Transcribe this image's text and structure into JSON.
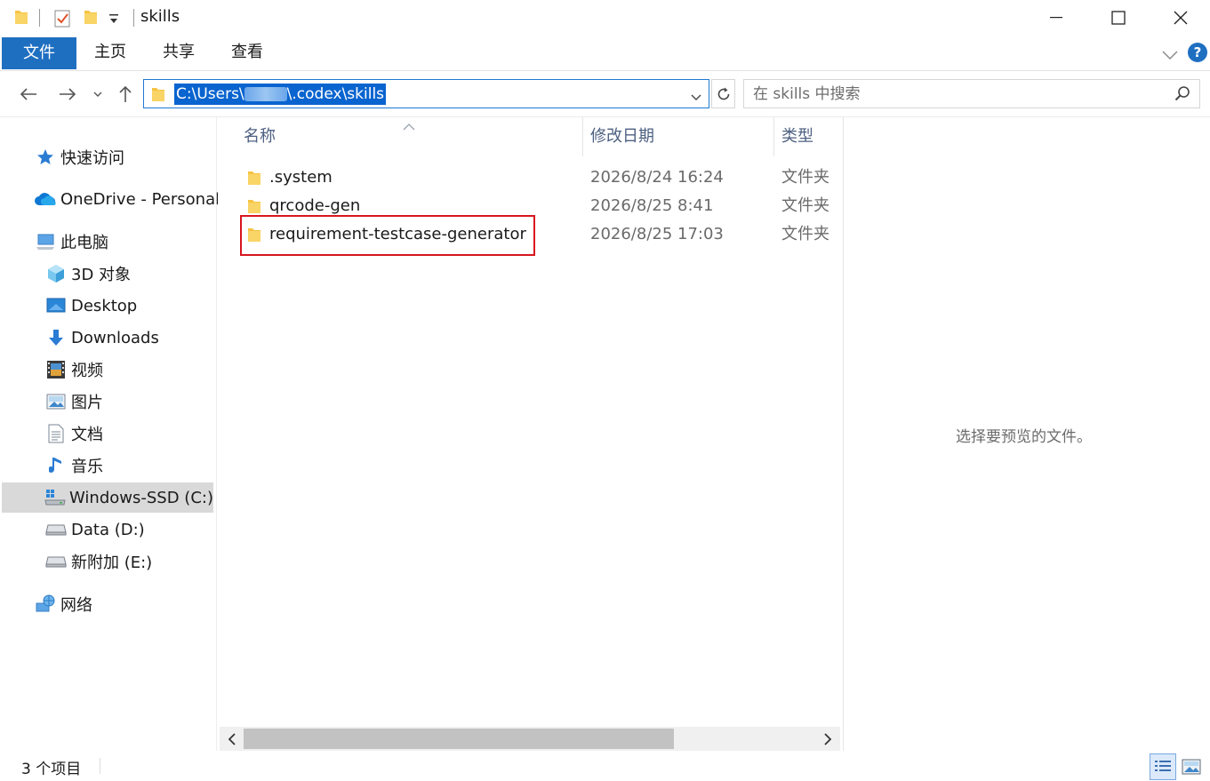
{
  "window": {
    "title": "skills",
    "minimize_glyph": "—",
    "close_glyph": "✕"
  },
  "ribbon": {
    "tabs": [
      {
        "label": "文件",
        "active": true
      },
      {
        "label": "主页"
      },
      {
        "label": "共享"
      },
      {
        "label": "查看"
      }
    ],
    "help_label": "?"
  },
  "address": {
    "path_prefix": "C:\\Users\\",
    "path_suffix": "\\.codex\\skills",
    "search_placeholder": "在 skills 中搜索"
  },
  "sidebar": {
    "items": [
      {
        "label": "快速访问",
        "icon": "star-icon"
      },
      {
        "label": "OneDrive - Personal",
        "icon": "cloud-icon"
      },
      {
        "label": "此电脑",
        "icon": "computer-icon"
      },
      {
        "label": "3D 对象",
        "icon": "cube-icon"
      },
      {
        "label": "Desktop",
        "icon": "desktop-icon"
      },
      {
        "label": "Downloads",
        "icon": "download-arrow-icon"
      },
      {
        "label": "视频",
        "icon": "film-icon"
      },
      {
        "label": "图片",
        "icon": "picture-icon"
      },
      {
        "label": "文档",
        "icon": "document-icon"
      },
      {
        "label": "音乐",
        "icon": "music-note-icon"
      },
      {
        "label": "Windows-SSD (C:)",
        "icon": "windows-drive-icon",
        "selected": true
      },
      {
        "label": "Data (D:)",
        "icon": "drive-icon"
      },
      {
        "label": "新附加 (E:)",
        "icon": "drive-icon"
      },
      {
        "label": "网络",
        "icon": "network-icon"
      }
    ]
  },
  "filelist": {
    "columns": {
      "name": "名称",
      "date": "修改日期",
      "type": "类型"
    },
    "rows": [
      {
        "name": ".system",
        "date": "2026/8/24 16:24",
        "type": "文件夹"
      },
      {
        "name": "qrcode-gen",
        "date": "2026/8/25 8:41",
        "type": "文件夹"
      },
      {
        "name": "requirement-testcase-generator",
        "date": "2026/8/25 17:03",
        "type": "文件夹"
      }
    ]
  },
  "preview": {
    "message": "选择要预览的文件。"
  },
  "status": {
    "item_count": "3 个项目"
  },
  "colors": {
    "accent": "#1f6fc1",
    "folder": "#f6c342",
    "highlight_border": "#d7161e",
    "selection": "#0a64cf"
  }
}
